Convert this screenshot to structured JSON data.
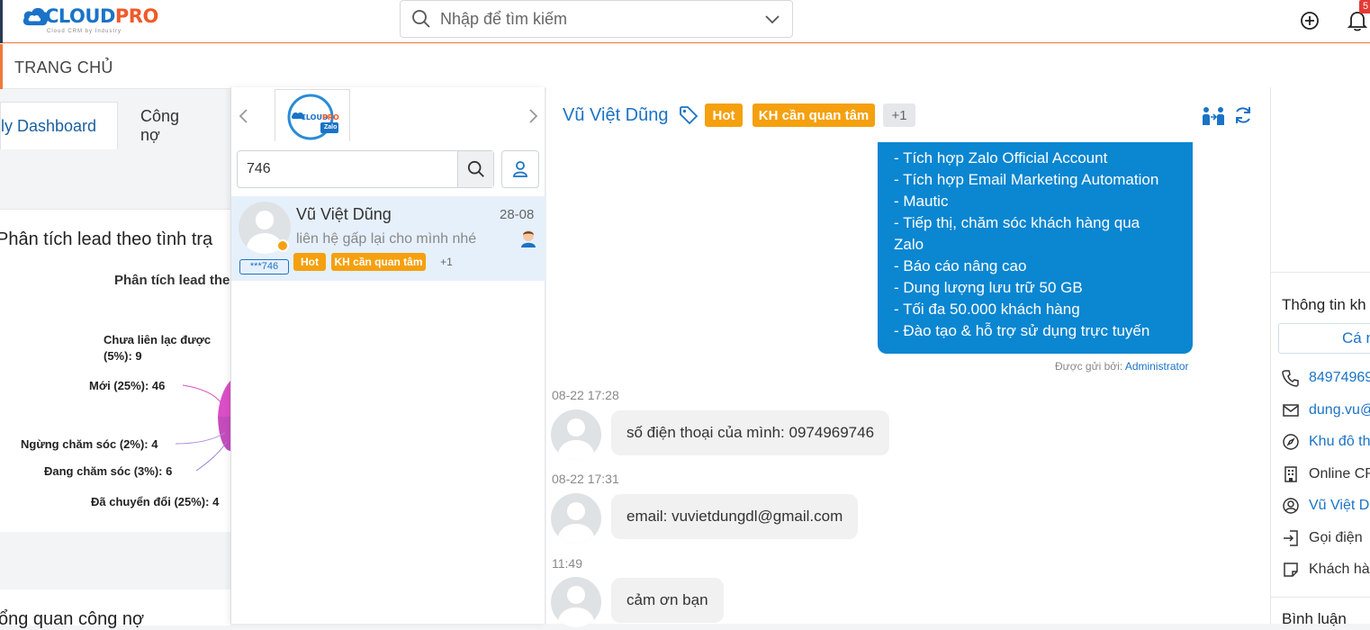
{
  "topbar": {
    "logo_word_a": "CLOUD",
    "logo_word_b": "PRO",
    "logo_tagline": "Cloud CRM by Industry",
    "search_placeholder": "Nhập để tìm kiếm",
    "notification_count": "5"
  },
  "subbar": {
    "title": "TRANG CHỦ"
  },
  "tabs": [
    {
      "label": "ly Dashboard"
    },
    {
      "label": "Công nợ"
    }
  ],
  "dashboard": {
    "card_title": "Phân tích lead theo tình trạ",
    "chart_title": "Phân tích lead the",
    "bottom_title": "ổng quan công nợ",
    "chart_data": {
      "type": "pie",
      "labels": [
        "Chưa liên lạc được",
        "Mới",
        "Ngừng chăm sóc",
        "Đang chăm sóc",
        "Đã chuyển đổi"
      ],
      "label_lines": [
        "Chưa liên lạc được",
        "(5%): 9",
        "Mới (25%): 46",
        "Ngừng chăm sóc (2%): 4",
        "Đang chăm sóc (3%): 6",
        "Đã chuyển đổi (25%): 4"
      ],
      "percents": [
        5,
        25,
        2,
        3,
        25
      ],
      "colors": [
        "#c2185b",
        "#d94fc5",
        "#9c6ad6",
        "#8e7fd8",
        "#e067c9"
      ]
    }
  },
  "conversations": {
    "search_value": "746",
    "oa_badge": "Zalo",
    "items": [
      {
        "name": "Vũ Việt Dũng",
        "date": "28-08",
        "preview": "liên hệ gấp lại cho mình nhé",
        "phone_tag": "***746",
        "tags": [
          "Hot",
          "KH cần quan tâm"
        ],
        "more": "+1"
      }
    ]
  },
  "chat": {
    "contact_name": "Vũ Việt Dũng",
    "tags": [
      "Hot",
      "KH cần quan tâm"
    ],
    "more": "+1",
    "outgoing_lines": [
      "- Tích hợp Zalo Official Account",
      "- Tích hợp Email Marketing Automation",
      "- Mautic",
      "- Tiếp thị, chăm sóc khách hàng qua",
      "Zalo",
      "- Báo cáo nâng cao",
      "- Dung lượng lưu trữ 50 GB",
      "- Tối đa 50.000 khách hàng",
      "- Đào tạo & hỗ trợ sử dụng trực tuyến"
    ],
    "sent_by_label": "Được gửi bởi:",
    "sent_by_name": "Administrator",
    "messages": [
      {
        "time": "08-22 17:28",
        "text": "số điện thoại của mình: 0974969746"
      },
      {
        "time": "08-22 17:31",
        "text": "email: vuvietdungdl@gmail.com"
      },
      {
        "time": "11:49",
        "text": "cảm ơn bạn"
      }
    ]
  },
  "info": {
    "title": "Thông tin kh",
    "button": "Cá n",
    "rows": [
      {
        "icon": "phone-icon",
        "text": "84974969",
        "link": true
      },
      {
        "icon": "mail-icon",
        "text": "dung.vu@",
        "link": true
      },
      {
        "icon": "compass-icon",
        "text": "Khu đô th",
        "link": true
      },
      {
        "icon": "building-icon",
        "text": "Online CR",
        "link": false
      },
      {
        "icon": "user-circle-icon",
        "text": "Vũ Việt Dũ",
        "link": true
      },
      {
        "icon": "login-icon",
        "text": "Gọi điện",
        "link": false
      },
      {
        "icon": "note-icon",
        "text": "Khách hàn",
        "link": false
      }
    ],
    "comments_title": "Bình luận"
  }
}
